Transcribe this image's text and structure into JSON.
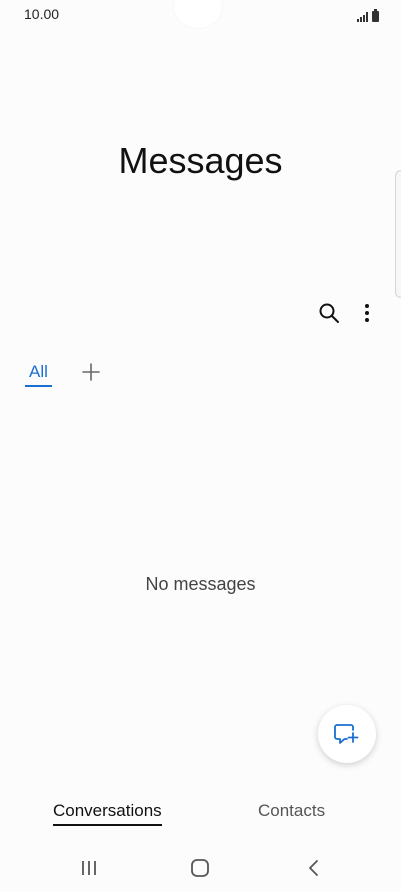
{
  "status_bar": {
    "time": "10.00",
    "signal_icon": "signal-icon",
    "battery_icon": "battery-icon"
  },
  "header": {
    "title": "Messages"
  },
  "toolbar": {
    "search_icon": "search-icon",
    "more_icon": "more-vertical-icon"
  },
  "filter_tabs": {
    "all_label": "All",
    "add_icon": "plus-icon"
  },
  "main": {
    "empty_text": "No messages"
  },
  "fab": {
    "icon": "compose-message-icon"
  },
  "bottom_tabs": {
    "conversations_label": "Conversations",
    "contacts_label": "Contacts"
  },
  "nav_bar": {
    "recents_icon": "recents-icon",
    "home_icon": "home-icon",
    "back_icon": "back-icon"
  },
  "colors": {
    "accent": "#1a6fd1",
    "background": "#fcfcfc",
    "text": "#111111"
  }
}
